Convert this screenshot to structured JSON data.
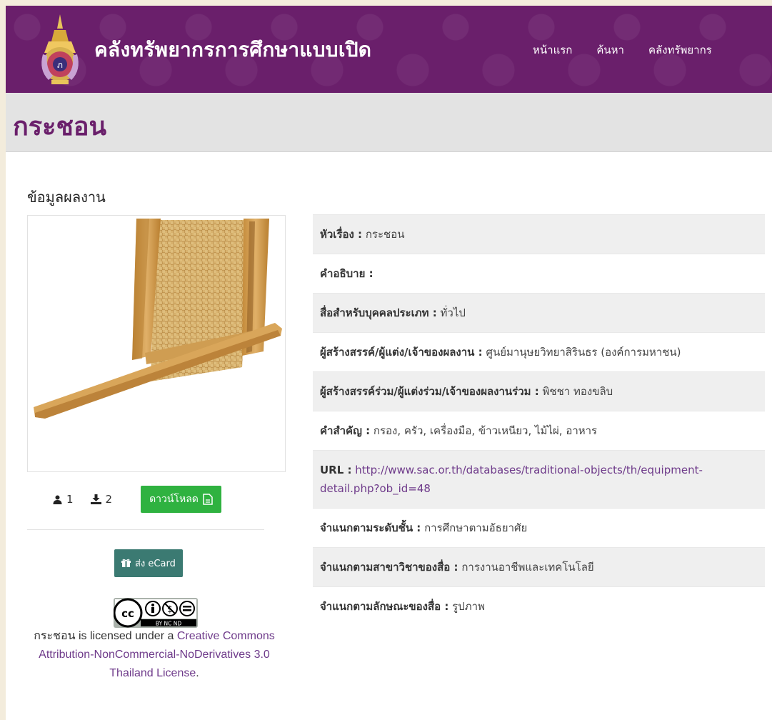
{
  "header": {
    "site_title": "คลังทรัพยากรการศึกษาแบบเปิด",
    "nav": [
      "หน้าแรก",
      "ค้นหา",
      "คลังทรัพยากร"
    ]
  },
  "page": {
    "title": "กระชอน"
  },
  "section": {
    "heading": "ข้อมูลผลงาน"
  },
  "stats": {
    "views": "1",
    "downloads": "2"
  },
  "buttons": {
    "download": "ดาวน์โหลด",
    "ecard": "ส่ง eCard"
  },
  "license": {
    "cc_badge": "BY NC ND",
    "prefix": "กระชอน is licensed under a ",
    "link_text": "Creative Commons Attribution-NonCommercial-NoDerivatives 3.0 Thailand License",
    "suffix": "."
  },
  "metadata": [
    {
      "label": "หัวเรื่อง :",
      "value": "กระชอน"
    },
    {
      "label": "คำอธิบาย :",
      "value": ""
    },
    {
      "label": "สื่อสำหรับบุคคลประเภท :",
      "value": "ทั่วไป"
    },
    {
      "label": "ผู้สร้างสรรค์/ผู้แต่ง/เจ้าของผลงาน :",
      "value": "ศูนย์มานุษยวิทยาสิรินธร (องค์การมหาชน)"
    },
    {
      "label": "ผู้สร้างสรรค์ร่วม/ผู้แต่งร่วม/เจ้าของผลงานร่วม :",
      "value": "พิชชา ทองขลิบ"
    },
    {
      "label": "คำสำคัญ :",
      "value": "กรอง, ครัว, เครื่องมือ, ข้าวเหนียว, ไม้ไผ่, อาหาร"
    },
    {
      "label": "URL :",
      "value": "http://www.sac.or.th/databases/traditional-objects/th/equipment-detail.php?ob_id=48"
    },
    {
      "label": "จำแนกตามระดับชั้น :",
      "value": "การศึกษาตามอัธยาศัย"
    },
    {
      "label": "จำแนกตามสาขาวิชาของสื่อ :",
      "value": "การงานอาชีพและเทคโนโลยี"
    },
    {
      "label": "จำแนกตามลักษณะของสื่อ :",
      "value": "รูปภาพ"
    }
  ],
  "colors": {
    "header_bg": "#6a1f6b",
    "download_btn": "#2fb240",
    "ecard_btn": "#3b7a72",
    "link": "#6e3a8a"
  }
}
